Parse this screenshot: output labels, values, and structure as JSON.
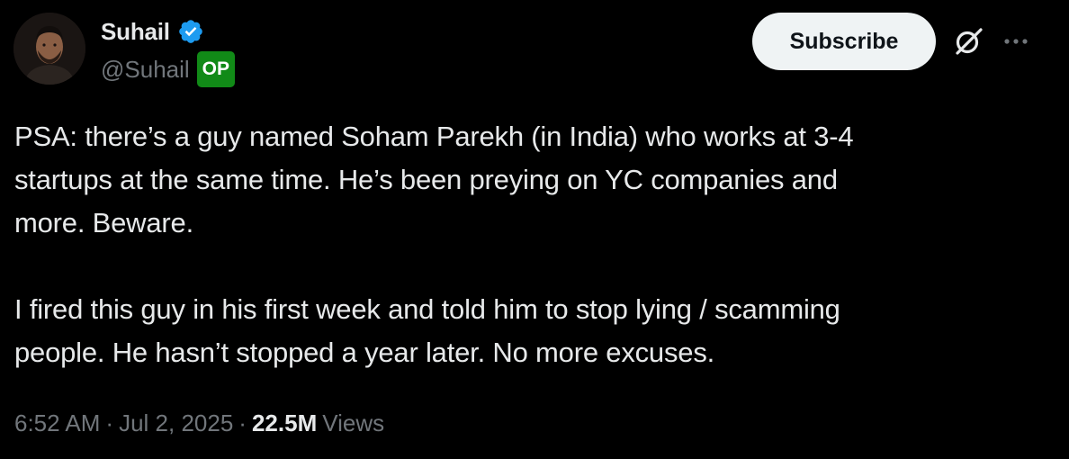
{
  "author": {
    "display_name": "Suhail",
    "handle": "@Suhail",
    "badge": "OP",
    "badge_color": "#118a17",
    "verified_color": "#1d9bf0",
    "avatar_icon": "profile-photo"
  },
  "actions": {
    "subscribe_label": "Subscribe",
    "grok_icon": "grok-icon",
    "more_icon": "more-horizontal-icon"
  },
  "post": {
    "paragraphs": [
      "PSA: there’s a guy named Soham Parekh (in India) who works at 3-4\nstartups at the same time. He’s been preying on YC companies and\nmore. Beware.",
      "I fired this guy in his first week and told him to stop lying / scamming\npeople. He hasn’t stopped a year later. No more excuses."
    ]
  },
  "meta": {
    "time": "6:52 AM",
    "separator": "·",
    "date": "Jul 2, 2025",
    "views_count": "22.5M",
    "views_label": "Views"
  },
  "colors": {
    "background": "#000000",
    "text_primary": "#e7e9ea",
    "text_secondary": "#71767b",
    "button_bg": "#eff3f4"
  }
}
